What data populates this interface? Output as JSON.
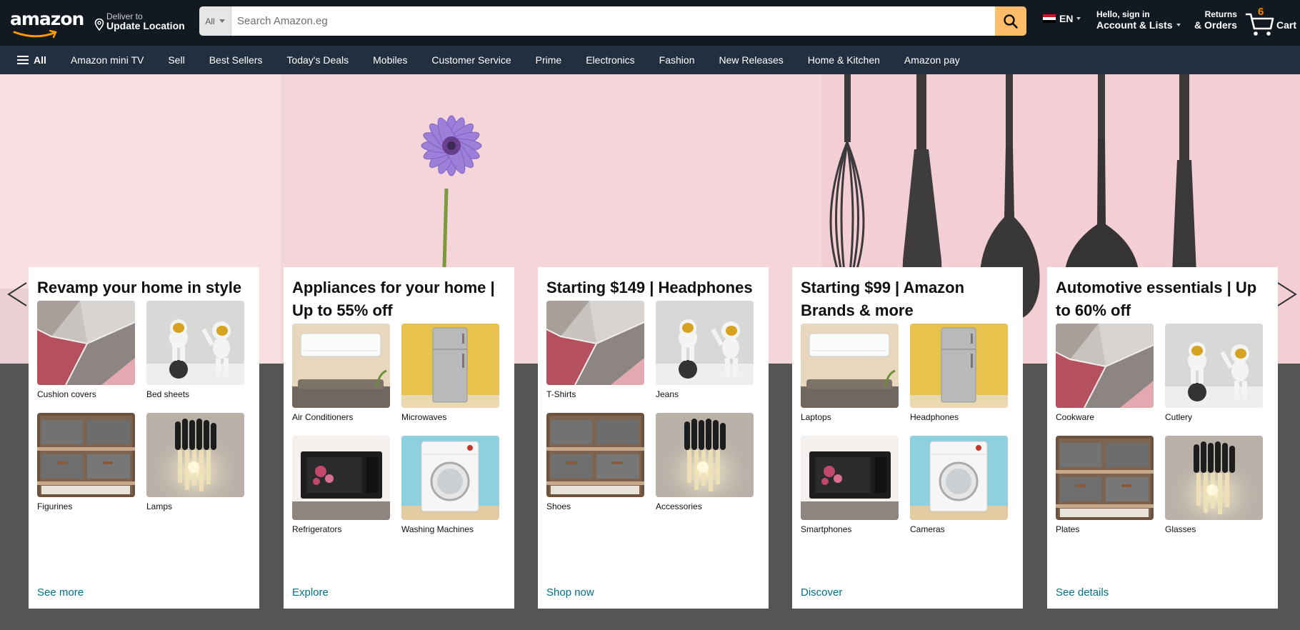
{
  "header": {
    "logo_text": "amazon",
    "deliver_small": "Deliver to",
    "deliver_big": "Update Location",
    "search_category": "All",
    "search_placeholder": "Search Amazon.eg",
    "language": "EN",
    "account_small": "Hello, sign in",
    "account_big": "Account & Lists",
    "returns_small": "Returns",
    "returns_big": "& Orders",
    "cart_count": "6",
    "cart_label": "Cart"
  },
  "nav": {
    "all_label": "All",
    "items": [
      "Amazon mini TV",
      "Sell",
      "Best Sellers",
      "Today's Deals",
      "Mobiles",
      "Customer Service",
      "Prime",
      "Electronics",
      "Fashion",
      "New Releases",
      "Home & Kitchen",
      "Amazon pay"
    ]
  },
  "colors": {
    "header_bg": "#131921",
    "nav_bg": "#232f3e",
    "search_button": "#febd69",
    "cart_count": "#f08804",
    "link": "#007185",
    "page_bg": "#555555"
  },
  "cards": [
    {
      "title": "Revamp your home in style",
      "tiles": [
        {
          "label": "Cushion covers",
          "image": "rug"
        },
        {
          "label": "Bed sheets",
          "image": "astronaut"
        },
        {
          "label": "Figurines",
          "image": "shelf"
        },
        {
          "label": "Lamps",
          "image": "lamp"
        }
      ],
      "link": "See more"
    },
    {
      "title": "Appliances for your home | Up to 55% off",
      "tiles": [
        {
          "label": "Air Conditioners",
          "image": "ac"
        },
        {
          "label": "Microwaves",
          "image": "fridge"
        },
        {
          "label": "Refrigerators",
          "image": "microwave"
        },
        {
          "label": "Washing Machines",
          "image": "washer"
        }
      ],
      "link": "Explore"
    },
    {
      "title": "Starting $149 | Headphones",
      "tiles": [
        {
          "label": "T-Shirts",
          "image": "rug"
        },
        {
          "label": "Jeans",
          "image": "astronaut"
        },
        {
          "label": "Shoes",
          "image": "shelf"
        },
        {
          "label": "Accessories",
          "image": "lamp"
        }
      ],
      "link": "Shop now"
    },
    {
      "title": "Starting $99 | Amazon Brands & more",
      "tiles": [
        {
          "label": "Laptops",
          "image": "ac"
        },
        {
          "label": "Headphones",
          "image": "fridge"
        },
        {
          "label": "Smartphones",
          "image": "microwave"
        },
        {
          "label": "Cameras",
          "image": "washer"
        }
      ],
      "link": "Discover"
    },
    {
      "title": "Automotive essentials | Up to 60% off",
      "tiles": [
        {
          "label": "Cookware",
          "image": "rug"
        },
        {
          "label": "Cutlery",
          "image": "astronaut"
        },
        {
          "label": "Plates",
          "image": "shelf"
        },
        {
          "label": "Glasses",
          "image": "lamp"
        }
      ],
      "link": "See details"
    }
  ]
}
